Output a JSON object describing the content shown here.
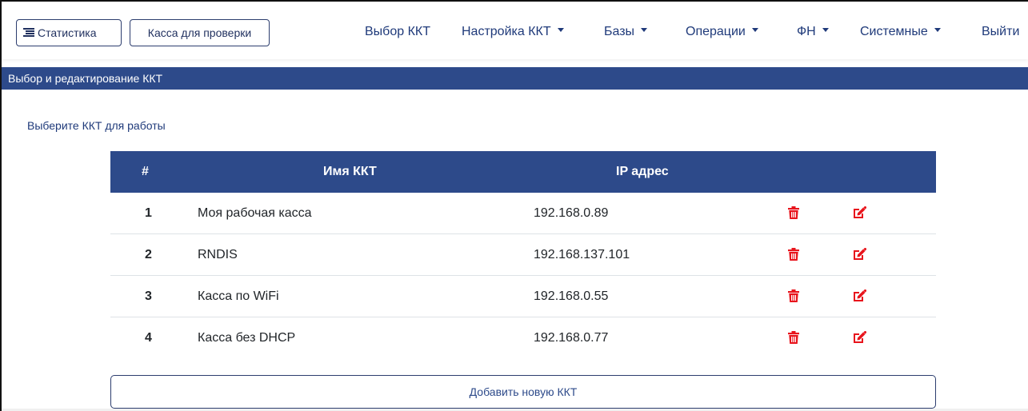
{
  "navbar": {
    "stats_button": "Статистика",
    "check_button": "Касса для проверки",
    "items": [
      {
        "label": "Выбор ККТ",
        "dropdown": false
      },
      {
        "label": "Настройка ККТ",
        "dropdown": true
      },
      {
        "label": "Базы",
        "dropdown": true
      },
      {
        "label": "Операции",
        "dropdown": true
      },
      {
        "label": "ФН",
        "dropdown": true
      },
      {
        "label": "Системные",
        "dropdown": true
      },
      {
        "label": "Выйти",
        "dropdown": false
      }
    ]
  },
  "section": {
    "title": "Выбор и редактирование ККТ",
    "prompt": "Выберите ККТ для работы"
  },
  "table": {
    "columns": [
      "#",
      "Имя ККТ",
      "IP адрес"
    ],
    "rows": [
      {
        "num": "1",
        "name": "Моя рабочая касса",
        "ip": "192.168.0.89"
      },
      {
        "num": "2",
        "name": "RNDIS",
        "ip": "192.168.137.101"
      },
      {
        "num": "3",
        "name": "Касса по WiFi",
        "ip": "192.168.0.55"
      },
      {
        "num": "4",
        "name": "Касса без DHCP",
        "ip": "192.168.0.77"
      }
    ],
    "row_actions": [
      "trash-icon",
      "edit-icon"
    ]
  },
  "add_button": "Добавить новую ККТ",
  "colors": {
    "primary": "#2d4a8a",
    "nav_text": "#1f3a7a",
    "danger": "#e8141c"
  }
}
